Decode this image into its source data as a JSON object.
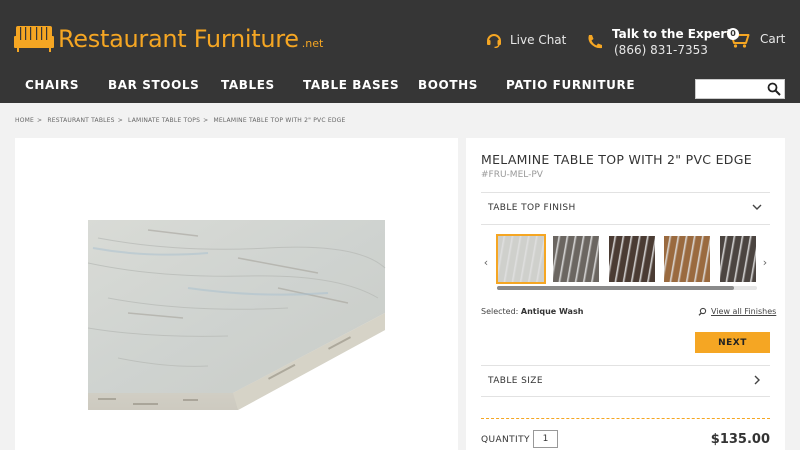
{
  "brand": {
    "name": "Restaurant Furniture",
    "suffix": ".net",
    "accent": "#f5a623"
  },
  "header": {
    "live_chat": "Live Chat",
    "experts_title": "Talk to the Experts",
    "experts_phone": "(866) 831-7353",
    "cart_label": "Cart",
    "cart_count": "0"
  },
  "nav": {
    "items": [
      {
        "label": "CHAIRS"
      },
      {
        "label": "BAR STOOLS"
      },
      {
        "label": "TABLES"
      },
      {
        "label": "TABLE BASES"
      },
      {
        "label": "BOOTHS"
      },
      {
        "label": "PATIO FURNITURE"
      }
    ],
    "search_placeholder": ""
  },
  "breadcrumb": [
    "HOME",
    "RESTAURANT TABLES",
    "LAMINATE TABLE TOPS",
    "MELAMINE TABLE TOP WITH 2\" PVC EDGE"
  ],
  "product": {
    "title": "MELAMINE TABLE TOP WITH 2\" PVC EDGE",
    "sku": "#FRU-MEL-PV",
    "finish_label": "TABLE TOP FINISH",
    "selected_prefix": "Selected:",
    "selected_finish": "Antique Wash",
    "view_all": "View all Finishes",
    "next_label": "NEXT",
    "size_label": "TABLE SIZE",
    "quantity_label": "QUANTITY",
    "quantity_value": "1",
    "price": "$135.00",
    "swatch_scroll_fraction": 0.91,
    "swatches": [
      {
        "name": "antique-wash",
        "color": "#cfd0cc"
      },
      {
        "name": "rustic-grey",
        "color": "#6b6661"
      },
      {
        "name": "dark-walnut",
        "color": "#4a3b33"
      },
      {
        "name": "honey-oak",
        "color": "#9a6a3f"
      },
      {
        "name": "charcoal-wood",
        "color": "#4b4440"
      }
    ]
  }
}
